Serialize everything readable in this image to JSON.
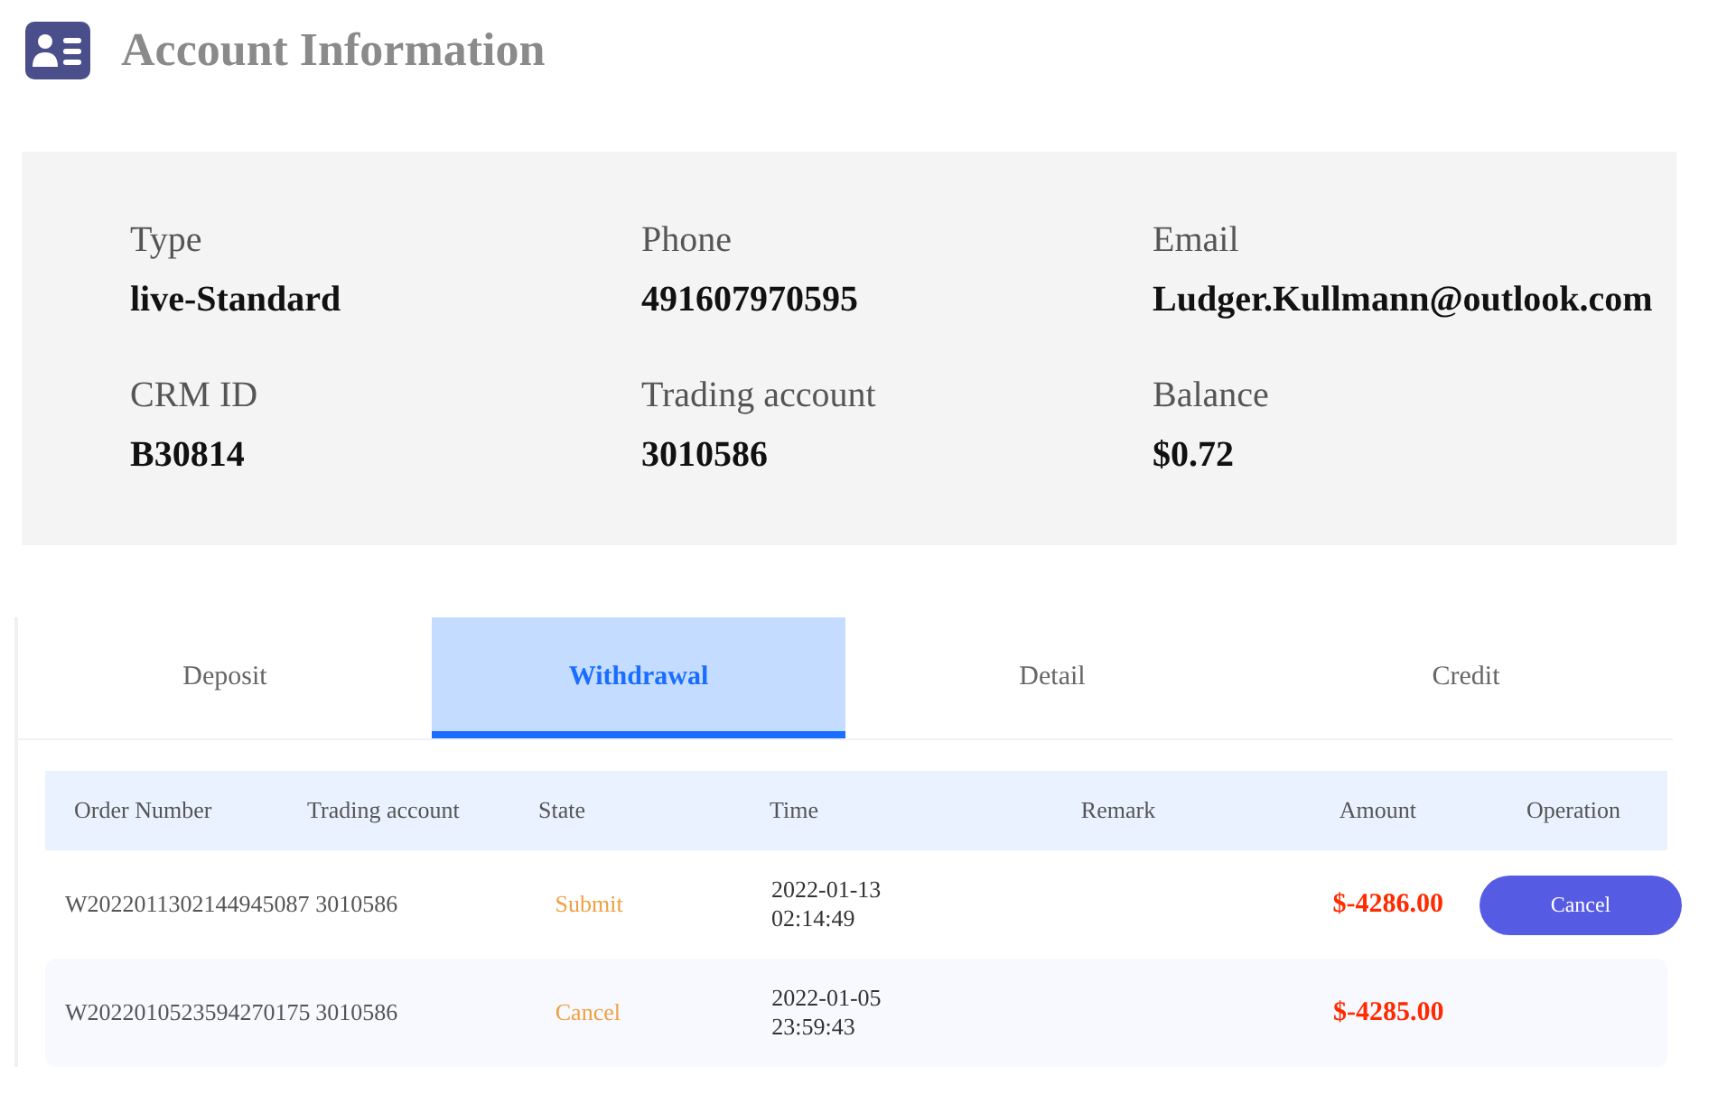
{
  "title": "Account Information",
  "info": [
    {
      "label": "Type",
      "value": "live-Standard"
    },
    {
      "label": "Phone",
      "value": "491607970595"
    },
    {
      "label": "Email",
      "value": "Ludger.Kullmann@outlook.com"
    },
    {
      "label": "CRM ID",
      "value": "B30814"
    },
    {
      "label": "Trading account",
      "value": "3010586"
    },
    {
      "label": "Balance",
      "value": "$0.72"
    }
  ],
  "tabs": [
    {
      "label": "Deposit",
      "selected": false
    },
    {
      "label": "Withdrawal",
      "selected": true
    },
    {
      "label": "Detail",
      "selected": false
    },
    {
      "label": "Credit",
      "selected": false
    }
  ],
  "table": {
    "columns": [
      "Order Number",
      "Trading account",
      "State",
      "Time",
      "Remark",
      "Amount",
      "Operation"
    ],
    "rows": [
      {
        "order": "W2022011302144945087",
        "account": "3010586",
        "state": "Submit",
        "date": "2022-01-13",
        "time": "02:14:49",
        "amount": "$-4286.00",
        "operation": "Cancel"
      },
      {
        "order": "W2022010523594270175",
        "account": "3010586",
        "state": "Cancel",
        "date": "2022-01-05",
        "time": "23:59:43",
        "amount": "$-4285.00"
      }
    ]
  }
}
